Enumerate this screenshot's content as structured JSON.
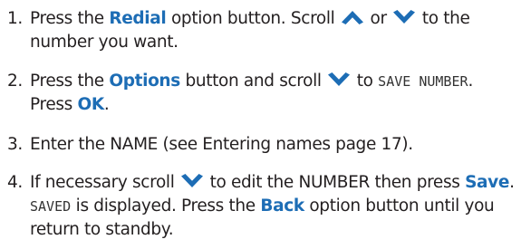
{
  "steps": [
    {
      "number": "1.",
      "segments": {
        "s1": "Press the ",
        "s2": "Redial",
        "s3": " option button. Scroll ",
        "s4": " or ",
        "s5": " to the",
        "s6": "number you want."
      }
    },
    {
      "number": "2.",
      "segments": {
        "s1": "Press the ",
        "s2": "Options",
        "s3": " button and scroll ",
        "s4": " to ",
        "s5": "SAVE NUMBER",
        "s6": ".",
        "s7": "Press ",
        "s8": "OK",
        "s9": "."
      }
    },
    {
      "number": "3.",
      "segments": {
        "s1": "Enter the NAME (see Entering names page 17)."
      }
    },
    {
      "number": "4.",
      "segments": {
        "s1": "If necessary scroll ",
        "s2": " to edit the NUMBER then press ",
        "s3": "Save",
        "s4": ".",
        "s5": "SAVED",
        "s6": " is displayed. Press the ",
        "s7": "Back",
        "s8": " option button until you",
        "s9": "return to standby."
      }
    }
  ],
  "icons": {
    "up": "chevron-up-icon",
    "down": "chevron-down-icon"
  },
  "colors": {
    "text": "#231f20",
    "highlight": "#1d6db5",
    "arrow": "#1d6db5"
  }
}
